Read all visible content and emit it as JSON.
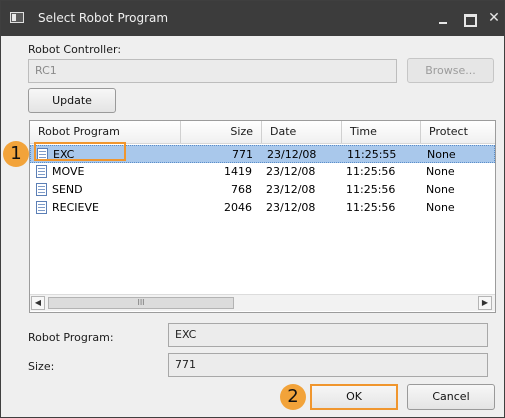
{
  "window": {
    "title": "Select Robot Program",
    "icon": "program-window-icon",
    "controls": {
      "minimize": "minimize-icon",
      "maximize": "maximize-icon",
      "close": "✕"
    }
  },
  "controller": {
    "label": "Robot Controller:",
    "value": "RC1",
    "browse_label": "Browse..."
  },
  "update_label": "Update",
  "program_list": {
    "columns": [
      "Robot Program",
      "Size",
      "Date",
      "Time",
      "Protect"
    ],
    "rows": [
      {
        "name": "EXC",
        "size": "771",
        "date": "23/12/08",
        "time": "11:25:55",
        "protect": "None",
        "selected": true
      },
      {
        "name": "MOVE",
        "size": "1419",
        "date": "23/12/08",
        "time": "11:25:56",
        "protect": "None",
        "selected": false
      },
      {
        "name": "SEND",
        "size": "768",
        "date": "23/12/08",
        "time": "11:25:56",
        "protect": "None",
        "selected": false
      },
      {
        "name": "RECIEVE",
        "size": "2046",
        "date": "23/12/08",
        "time": "11:25:56",
        "protect": "None",
        "selected": false
      }
    ],
    "row_icon": "document-icon",
    "scroll_left": "◀",
    "scroll_right": "▶",
    "scroll_grip": "III"
  },
  "details": {
    "program_label": "Robot Program:",
    "program_value": "EXC",
    "size_label": "Size:",
    "size_value": "771"
  },
  "buttons": {
    "ok": "OK",
    "cancel": "Cancel"
  },
  "callouts": {
    "one": "1",
    "two": "2"
  },
  "colors": {
    "titlebar": "#3c3c3c",
    "selection": "#a9c8eb",
    "callout": "#f2a33a",
    "highlight": "#f0962e"
  }
}
